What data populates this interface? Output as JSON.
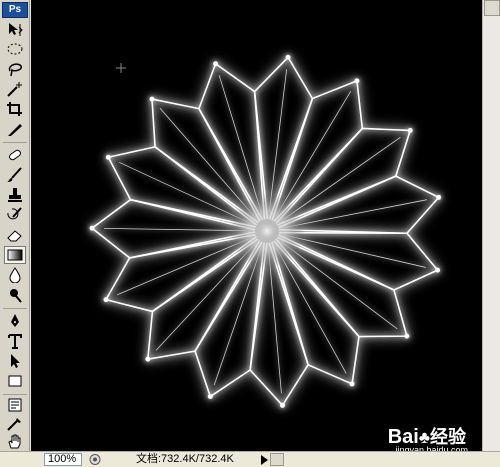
{
  "app": {
    "logo": "Ps"
  },
  "tools": [
    {
      "name": "move-tool-icon"
    },
    {
      "name": "marquee-tool-icon"
    },
    {
      "name": "lasso-tool-icon"
    },
    {
      "name": "magic-wand-icon"
    },
    {
      "name": "crop-tool-icon"
    },
    {
      "name": "slice-tool-icon"
    },
    {
      "name": "healing-brush-icon"
    },
    {
      "name": "brush-tool-icon"
    },
    {
      "name": "clone-stamp-icon"
    },
    {
      "name": "history-brush-icon"
    },
    {
      "name": "eraser-icon"
    },
    {
      "name": "gradient-tool-icon"
    },
    {
      "name": "blur-tool-icon"
    },
    {
      "name": "dodge-tool-icon"
    },
    {
      "name": "pen-tool-icon"
    },
    {
      "name": "type-tool-icon"
    },
    {
      "name": "path-select-icon"
    },
    {
      "name": "shape-tool-icon"
    },
    {
      "name": "notes-tool-icon"
    },
    {
      "name": "eyedropper-icon"
    },
    {
      "name": "hand-tool-icon"
    }
  ],
  "status": {
    "zoom": "100%",
    "doc_info": "文档:732.4K/732.4K"
  },
  "watermark": {
    "brand": "Bai",
    "brand_tail": "经验",
    "url": "jingyan.baidu.com"
  },
  "colors": {
    "canvas_bg": "#000000",
    "glow": "#ffffff"
  }
}
